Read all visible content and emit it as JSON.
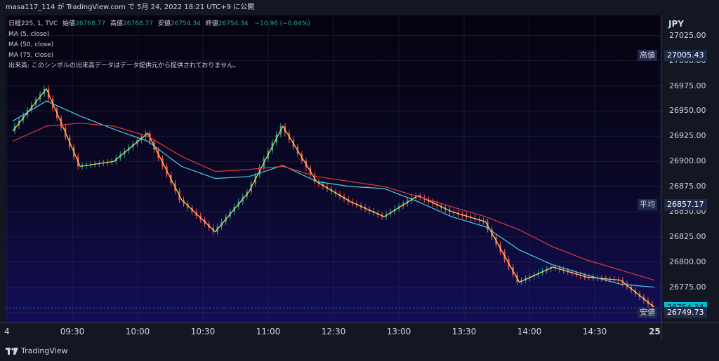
{
  "header": {
    "title": "masa117_114 が TradingView.com で 5月 24, 2022 18:21 UTC+9 に公開"
  },
  "legend": {
    "symbol": "日経225, 1, TVC",
    "open_label": "始値",
    "open": "26768.77",
    "high_label": "高値",
    "high": "26768.77",
    "low_label": "安値",
    "low": "26754.34",
    "close_label": "終値",
    "close": "26754.34",
    "change": "−10.96 (−0.04%)",
    "ma5": "MA (5, close)",
    "ma50": "MA (50, close)",
    "ma75": "MA (75, close)",
    "volume_note": "出来高: このシンボルの出来高データはデータ提供元から提供されておりません。"
  },
  "currency": "JPY",
  "tags": {
    "high": "高値",
    "avg": "平均",
    "low": "安値"
  },
  "labels": {
    "high": "27005.43",
    "avg": "26857.17",
    "last": "26754.34",
    "low": "26749.73"
  },
  "footer": {
    "brand": "TradingView"
  },
  "colors": {
    "up": "#26a69a",
    "down": "#ef5350",
    "ma5": "#ffd54f",
    "ma50": "#4dd0e1",
    "ma75": "#e53935",
    "last_bg": "#00bcd4",
    "label_bg": "#1e2a4a"
  },
  "chart_data": {
    "type": "line",
    "title": "日経225, 1, TVC",
    "ylim": [
      26740,
      27045
    ],
    "y_ticks": [
      27025,
      27000,
      26975,
      26950,
      26925,
      26900,
      26875,
      26850,
      26825,
      26800,
      26775,
      26750
    ],
    "y_tick_labels": [
      "27025.00",
      "27000.00",
      "26975.00",
      "26950.00",
      "26925.00",
      "26900.00",
      "26875.00",
      "26850.00",
      "26825.00",
      "26800.00",
      "26775.00",
      "26750.00"
    ],
    "x_ticks": [
      "4",
      "09:30",
      "10:00",
      "10:30",
      "11:00",
      "12:30",
      "13:00",
      "13:30",
      "14:00",
      "14:30",
      "25"
    ],
    "x": [
      "09:00",
      "09:15",
      "09:30",
      "09:45",
      "10:00",
      "10:15",
      "10:30",
      "10:45",
      "11:00",
      "12:30",
      "12:45",
      "13:00",
      "13:15",
      "13:30",
      "13:45",
      "14:00",
      "14:15",
      "14:30",
      "14:45",
      "15:00"
    ],
    "series": [
      {
        "name": "MA (5, close)",
        "values": [
          26930,
          26972,
          26895,
          26900,
          26928,
          26862,
          26830,
          26870,
          26935,
          26880,
          26860,
          26845,
          26866,
          26850,
          26840,
          26780,
          26795,
          26785,
          26782,
          26755
        ]
      },
      {
        "name": "MA (50, close)",
        "values": [
          26940,
          26960,
          26945,
          26932,
          26920,
          26895,
          26883,
          26885,
          26896,
          26880,
          26875,
          26873,
          26860,
          26845,
          26835,
          26812,
          26797,
          26787,
          26778,
          26775
        ]
      },
      {
        "name": "MA (75, close)",
        "values": [
          26920,
          26935,
          26938,
          26935,
          26925,
          26905,
          26890,
          26892,
          26895,
          26885,
          26880,
          26875,
          26865,
          26855,
          26845,
          26832,
          26815,
          26802,
          26792,
          26782
        ]
      }
    ]
  }
}
